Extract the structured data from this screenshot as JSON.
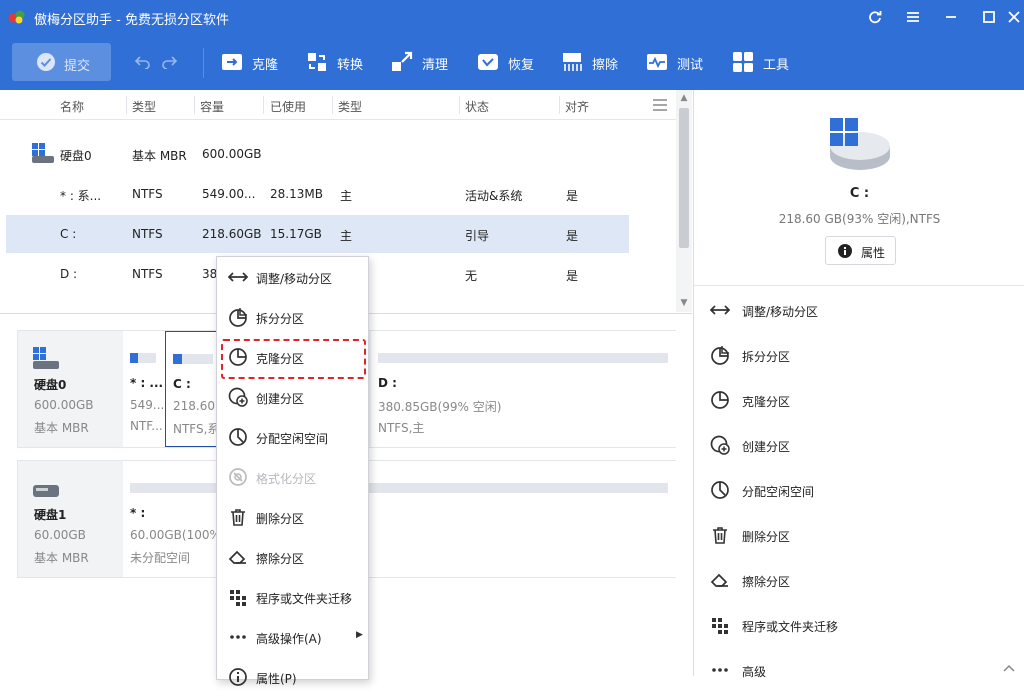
{
  "app": {
    "title": "傲梅分区助手 - 免费无损分区软件"
  },
  "toolbar": {
    "submit_label": "提交",
    "tools": [
      {
        "label": "克隆",
        "icon": "clone-icon"
      },
      {
        "label": "转换",
        "icon": "convert-icon"
      },
      {
        "label": "清理",
        "icon": "cleanup-icon"
      },
      {
        "label": "恢复",
        "icon": "recover-icon"
      },
      {
        "label": "擦除",
        "icon": "wipe-icon"
      },
      {
        "label": "测试",
        "icon": "test-icon"
      },
      {
        "label": "工具",
        "icon": "tools-icon"
      }
    ]
  },
  "table": {
    "headers": [
      "名称",
      "类型",
      "容量",
      "已使用",
      "类型",
      "状态",
      "对齐"
    ],
    "rows": [
      {
        "name": "硬盘0",
        "type": "基本 MBR",
        "capacity": "600.00GB",
        "used": "",
        "ptype": "",
        "status": "",
        "align": ""
      },
      {
        "name": "* : 系...",
        "type": "NTFS",
        "capacity": "549.00...",
        "used": "28.13MB",
        "ptype": "主",
        "status": "活动&系统",
        "align": "是"
      },
      {
        "name": "C :",
        "type": "NTFS",
        "capacity": "218.60GB",
        "used": "15.17GB",
        "ptype": "主",
        "status": "引导",
        "align": "是"
      },
      {
        "name": "D :",
        "type": "NTFS",
        "capacity": "38",
        "used": "",
        "ptype": "",
        "status": "无",
        "align": "是"
      }
    ]
  },
  "diskmap": {
    "disks": [
      {
        "name": "硬盘0",
        "size": "600.00GB",
        "kind": "基本 MBR",
        "partitions": [
          {
            "name": "* : ...",
            "info": "549...",
            "fs": "NTF...",
            "used_fraction": 0.3
          },
          {
            "name": "C :",
            "info": "218.60",
            "fs": "NTFS,系",
            "used_fraction": 0.07
          },
          {
            "name": "D :",
            "info": "380.85GB(99% 空闲)",
            "fs": "NTFS,主",
            "used_fraction": 0.01
          }
        ]
      },
      {
        "name": "硬盘1",
        "size": "60.00GB",
        "kind": "基本 MBR",
        "partitions": [
          {
            "name": "* :",
            "info": "60.00GB(100%",
            "fs": "未分配空间",
            "used_fraction": 0
          }
        ]
      }
    ]
  },
  "right_panel": {
    "title": "C :",
    "subtitle": "218.60 GB(93% 空闲),NTFS",
    "properties_label": "属性",
    "actions": [
      {
        "label": "调整/移动分区",
        "icon": "resize-move-icon"
      },
      {
        "label": "拆分分区",
        "icon": "split-partition-icon"
      },
      {
        "label": "克隆分区",
        "icon": "clone-partition-icon"
      },
      {
        "label": "创建分区",
        "icon": "create-partition-icon"
      },
      {
        "label": "分配空闲空间",
        "icon": "allocate-space-icon"
      },
      {
        "label": "删除分区",
        "icon": "delete-icon"
      },
      {
        "label": "擦除分区",
        "icon": "eraser-icon"
      },
      {
        "label": "程序或文件夹迁移",
        "icon": "migrate-icon"
      },
      {
        "label": "高级",
        "icon": "more-icon"
      }
    ]
  },
  "context_menu": {
    "items": [
      {
        "label": "调整/移动分区",
        "icon": "resize-move-icon",
        "enabled": true
      },
      {
        "label": "拆分分区",
        "icon": "split-partition-icon",
        "enabled": true
      },
      {
        "label": "克隆分区",
        "icon": "clone-partition-icon",
        "enabled": true,
        "highlighted": true
      },
      {
        "label": "创建分区",
        "icon": "create-partition-icon",
        "enabled": true
      },
      {
        "label": "分配空闲空间",
        "icon": "allocate-space-icon",
        "enabled": true
      },
      {
        "label": "格式化分区",
        "icon": "format-icon",
        "enabled": false
      },
      {
        "label": "删除分区",
        "icon": "delete-icon",
        "enabled": true
      },
      {
        "label": "擦除分区",
        "icon": "eraser-icon",
        "enabled": true
      },
      {
        "label": "程序或文件夹迁移",
        "icon": "migrate-icon",
        "enabled": true
      },
      {
        "label": "高级操作(A)",
        "icon": "more-icon",
        "enabled": true,
        "submenu": true
      },
      {
        "label": "属性(P)",
        "icon": "info-icon",
        "enabled": true
      }
    ]
  },
  "colors": {
    "brand_blue": "#2f6fd6",
    "selection": "#dde7f5",
    "highlight_red": "#e0242a"
  }
}
